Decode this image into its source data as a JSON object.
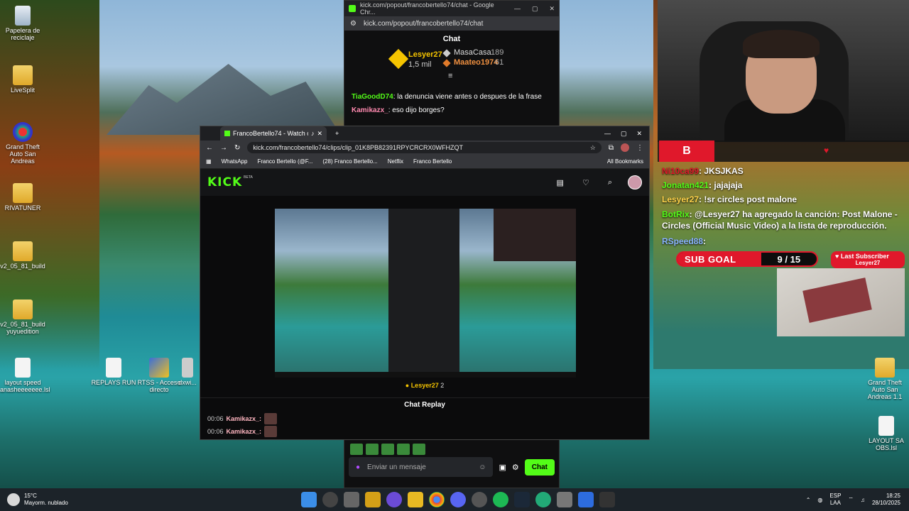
{
  "desktop": {
    "icons_left": [
      {
        "label": "Papelera de reciclaje",
        "kind": "recycle"
      },
      {
        "label": "LiveSplit",
        "kind": "folder"
      },
      {
        "label": "Grand Theft Auto San Andreas",
        "kind": "app"
      },
      {
        "label": "RIVATUNER",
        "kind": "folder"
      },
      {
        "label": "v2_05_81_build",
        "kind": "folder"
      },
      {
        "label": "v2_05_81_build yuyuedition",
        "kind": "folder"
      },
      {
        "label": "layout speed anasheeeeeee.lsl",
        "kind": "file"
      }
    ],
    "icons_bottom": [
      {
        "label": "REPLAYS RUN",
        "kind": "file"
      },
      {
        "label": "RTSS - Acceso directo",
        "kind": "app"
      },
      {
        "label": "dxwi...",
        "kind": "file"
      }
    ],
    "icons_right": [
      {
        "label": "Grand Theft Auto San Andreas 1.1",
        "kind": "folder"
      },
      {
        "label": "LAYOUT SA OBS.lsl",
        "kind": "file"
      }
    ]
  },
  "popout": {
    "window_title": "kick.com/popout/francobertello74/chat - Google Chr...",
    "url": "kick.com/popout/francobertello74/chat",
    "header": "Chat",
    "podium": {
      "first": {
        "name": "Lesyer27",
        "amount": "1,5 mil"
      },
      "second": {
        "name": "MasaCasa",
        "amount": "189"
      },
      "third": {
        "name": "Maateo1974",
        "amount": "61"
      }
    },
    "messages": [
      {
        "user": "TiaGoodD74",
        "text": ": la denuncia viene antes o despues de la frase"
      },
      {
        "user": "Kamikazx_",
        "text": ": eso dijo borges?"
      }
    ],
    "input_placeholder": "Enviar un mensaje",
    "send_label": "Chat"
  },
  "browser": {
    "tab_title": "FrancoBertello74 - Watch c",
    "url": "kick.com/francobertello74/clips/clip_01K8PB82391RPYCRCRX0WFHZQT",
    "bookmarks": [
      "WhatsApp",
      "Franco Bertello (@F...",
      "(28) Franco Bertello...",
      "Netflix",
      "Franco Bertello"
    ],
    "all_bookmarks": "All Bookmarks",
    "logo": "KICK",
    "logo_badge": "BETA",
    "clip_author": "Lesyer27",
    "clip_count": "2",
    "chat_replay": "Chat Replay",
    "replay_rows": [
      {
        "time": "00:06",
        "user": "Kamikazx_:"
      },
      {
        "time": "00:06",
        "user": "Kamikazx_:"
      }
    ]
  },
  "overlay": {
    "logo_text": "B",
    "messages": [
      {
        "user": "Ni10ca99",
        "text": ": JKSJKAS",
        "color": "#e0182b"
      },
      {
        "user": "Jonatan421",
        "text": ": jajajaja",
        "color": "#53fc18"
      },
      {
        "user": "Lesyer27",
        "text": ": !sr circles post malone",
        "color": "#ffd24a"
      },
      {
        "user": "BotRix",
        "text": ": @Lesyer27 ha agregado la canción: Post Malone - Circles (Official Music Video) a la lista de reproducción.",
        "color": "#53fc18"
      },
      {
        "user": "RSpeed88",
        "text": ":",
        "color": "#8ab4ff"
      }
    ],
    "sub_goal_label": "SUB GOAL",
    "sub_goal_value": "9 / 15",
    "sub_goal_progress": 0.6,
    "last_sub_label": "Last Subscriber",
    "last_sub_name": "Lesyer27"
  },
  "taskbar": {
    "weather_temp": "15°C",
    "weather_desc": "Mayorm. nublado",
    "lang": "ESP",
    "lang2": "LAA",
    "time": "18:25",
    "date": "28/10/2025"
  }
}
